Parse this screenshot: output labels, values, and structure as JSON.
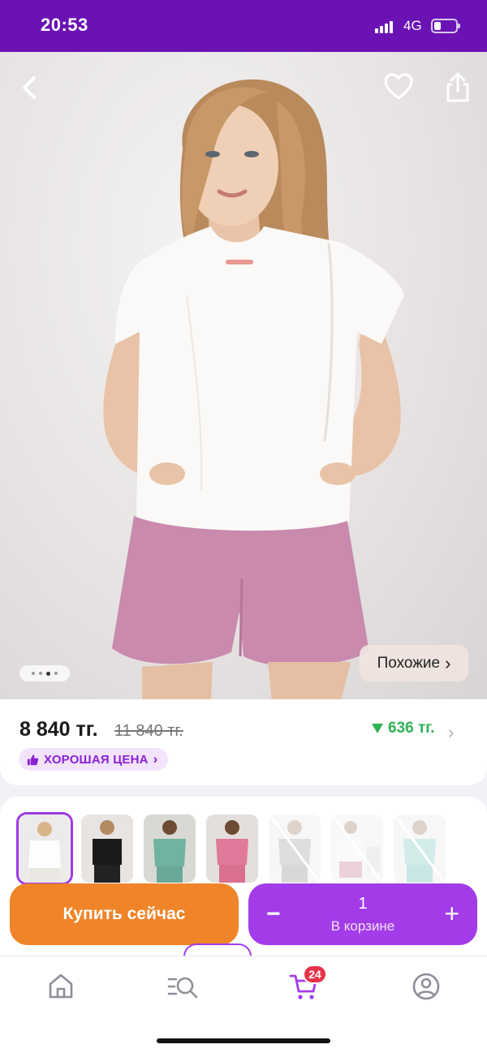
{
  "status_bar": {
    "time": "20:53",
    "network": "4G"
  },
  "product": {
    "price": "8 840 тг.",
    "old_price": "11 840 тг.",
    "discount": "636 тг.",
    "badge": "ХОРОШАЯ ЦЕНА",
    "similar_label": "Похожие"
  },
  "gallery": {
    "image_count": 4,
    "active_index": 2
  },
  "thumbnails": [
    {
      "name": "white-tshirt-set",
      "selected": true,
      "available": true
    },
    {
      "name": "black-set",
      "selected": false,
      "available": true
    },
    {
      "name": "mint-set",
      "selected": false,
      "available": true
    },
    {
      "name": "pink-set",
      "selected": false,
      "available": true
    },
    {
      "name": "gray-set",
      "selected": false,
      "available": false
    },
    {
      "name": "white-pink-set",
      "selected": false,
      "available": false
    },
    {
      "name": "light-blue-set",
      "selected": false,
      "available": false
    }
  ],
  "actions": {
    "buy_now": "Купить сейчас",
    "cart_quantity": "1",
    "in_cart": "В корзине",
    "minus": "−",
    "plus": "+"
  },
  "tabbar": {
    "cart_count": "24"
  },
  "colors": {
    "brand": "#6b12b5",
    "buy": "#f08428",
    "cart": "#a33be8",
    "discount": "#2fb255",
    "badge_bg": "#f3e4fc",
    "badge_text": "#8a21d5"
  }
}
